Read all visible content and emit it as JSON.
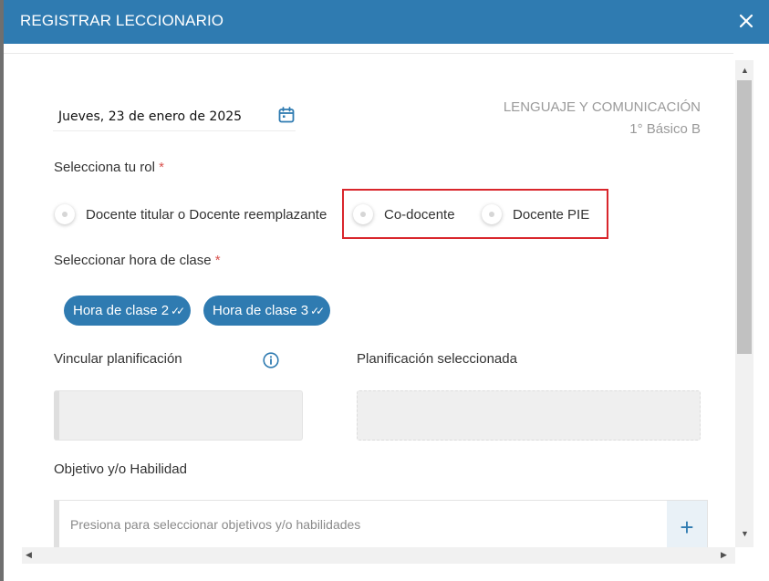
{
  "header": {
    "title": "REGISTRAR LECCIONARIO",
    "close_symbol": "✕"
  },
  "date": {
    "value": "Jueves, 23 de enero de 2025",
    "icon": "calendar-icon"
  },
  "subject": {
    "name": "LENGUAJE Y COMUNICACIÓN",
    "course": "1° Básico B"
  },
  "role": {
    "label": "Selecciona tu rol",
    "required_mark": "*",
    "options": [
      "Docente titular o Docente reemplazante",
      "Co-docente",
      "Docente PIE"
    ]
  },
  "class_hour": {
    "label": "Seleccionar hora de clase",
    "required_mark": "*",
    "chips": [
      "Hora de clase 2",
      "Hora de clase 3"
    ],
    "check_symbol": "✓✓"
  },
  "planning": {
    "link_label": "Vincular planificación",
    "selected_label": "Planificación seleccionada"
  },
  "objective": {
    "label": "Objetivo y/o Habilidad",
    "placeholder": "Presiona para seleccionar objetivos y/o habilidades",
    "add_symbol": "+"
  },
  "colors": {
    "header": "#2f7bb1",
    "accent": "#2f7bb1",
    "required": "#d9534f",
    "highlight_box": "#d9262c"
  },
  "scrollbar": {
    "up": "▲",
    "down": "▼",
    "left": "◀",
    "right": "▶"
  }
}
